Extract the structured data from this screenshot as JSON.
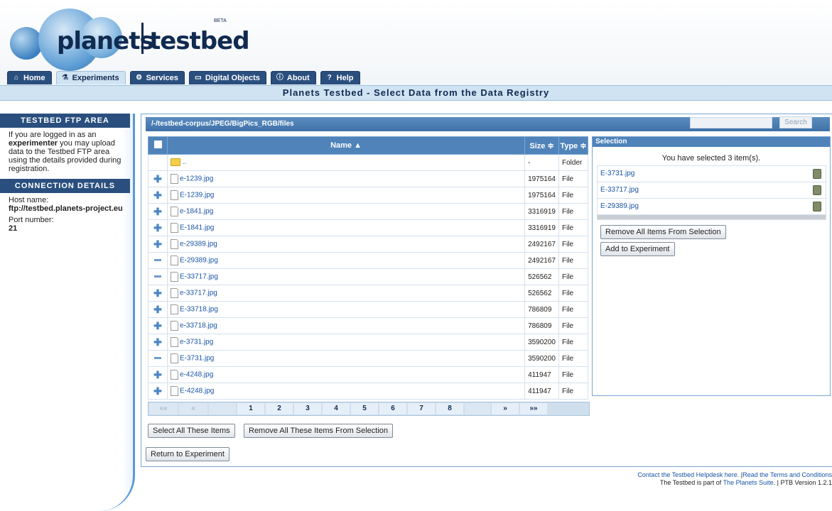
{
  "logo": {
    "word1": "planets",
    "word2": "testbed",
    "beta": "BETA"
  },
  "tabs": [
    {
      "label": "Home",
      "icon": "home-icon"
    },
    {
      "label": "Experiments",
      "icon": "flask-icon"
    },
    {
      "label": "Services",
      "icon": "gear-icon"
    },
    {
      "label": "Digital Objects",
      "icon": "folder-icon"
    },
    {
      "label": "About",
      "icon": "info-icon"
    },
    {
      "label": "Help",
      "icon": "help-icon"
    }
  ],
  "page_title": "Planets Testbed - Select Data from the Data Registry",
  "sidebar": {
    "ftp_heading": "TESTBED FTP AREA",
    "ftp_text_1": "If you are logged in as an",
    "ftp_text_bold": "experimenter",
    "ftp_text_2": "you may upload data to the Testbed FTP area using the details provided during registration.",
    "conn_heading": "CONNECTION DETAILS",
    "host_label": "Host name:",
    "host_value": "ftp://testbed.planets-project.eu",
    "port_label": "Port number:",
    "port_value": "21"
  },
  "browser": {
    "path": "/-/testbed-corpus/JPEG/BigPics_RGB/files",
    "search_placeholder": "",
    "search_button": "Search",
    "col_name": "Name ▲",
    "col_size": "Size ≑",
    "col_type": "Type ≑",
    "parent_name": "..",
    "parent_size": "-",
    "parent_type": "Folder",
    "rows": [
      {
        "action": "plus",
        "name": "e-1239.jpg",
        "size": "1975164",
        "type": "File"
      },
      {
        "action": "plus",
        "name": "E-1239.jpg",
        "size": "1975164",
        "type": "File"
      },
      {
        "action": "plus",
        "name": "e-1841.jpg",
        "size": "3316919",
        "type": "File"
      },
      {
        "action": "plus",
        "name": "E-1841.jpg",
        "size": "3316919",
        "type": "File"
      },
      {
        "action": "plus",
        "name": "e-29389.jpg",
        "size": "2492167",
        "type": "File"
      },
      {
        "action": "minus",
        "name": "E-29389.jpg",
        "size": "2492167",
        "type": "File"
      },
      {
        "action": "minus",
        "name": "E-33717.jpg",
        "size": "526562",
        "type": "File"
      },
      {
        "action": "plus",
        "name": "e-33717.jpg",
        "size": "526562",
        "type": "File"
      },
      {
        "action": "plus",
        "name": "E-33718.jpg",
        "size": "786809",
        "type": "File"
      },
      {
        "action": "plus",
        "name": "e-33718.jpg",
        "size": "786809",
        "type": "File"
      },
      {
        "action": "plus",
        "name": "e-3731.jpg",
        "size": "3590200",
        "type": "File"
      },
      {
        "action": "minus",
        "name": "E-3731.jpg",
        "size": "3590200",
        "type": "File"
      },
      {
        "action": "plus",
        "name": "e-4248.jpg",
        "size": "411947",
        "type": "File"
      },
      {
        "action": "plus",
        "name": "E-4248.jpg",
        "size": "411947",
        "type": "File"
      }
    ],
    "pager": {
      "first": "««",
      "prev": "«",
      "pages": [
        "1",
        "2",
        "3",
        "4",
        "5",
        "6",
        "7",
        "8"
      ],
      "next": "»",
      "last": "»»",
      "current": "1"
    },
    "select_all_label": "Select All These Items",
    "remove_all_these_label": "Remove All These Items From Selection",
    "return_label": "Return to Experiment"
  },
  "selection": {
    "heading": "Selection",
    "message": "You have selected 3 item(s).",
    "items": [
      "E-3731.jpg",
      "E-33717.jpg",
      "E-29389.jpg"
    ],
    "remove_all_label": "Remove All Items From Selection",
    "add_label": "Add to Experiment"
  },
  "footer": {
    "helpdesk_link": "Contact the Testbed Helpdesk here.",
    "sep1": " |",
    "terms_link": "Read the Terms and Conditions",
    "line2_prefix": "The Testbed is part of ",
    "suite_link": "The Planets Suite",
    "line2_suffix": ". | PTB Version 1.2.1"
  },
  "colors": {
    "header_blue": "#2a4f7e",
    "accent_light": "#cfe3f2",
    "table_head": "#4f83ba",
    "link": "#1a55a8"
  }
}
